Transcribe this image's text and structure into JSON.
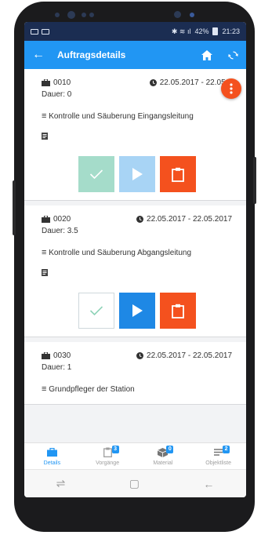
{
  "status_bar": {
    "battery": "42%",
    "time": "21:23"
  },
  "app_bar": {
    "title": "Auftragsdetails",
    "back_icon": "arrow-left-icon",
    "home_icon": "home-icon",
    "refresh_icon": "refresh-icon"
  },
  "orders": [
    {
      "id": "0010",
      "date": "22.05.2017 - 22.05.2",
      "duration": "Dauer: 0",
      "description": "Kontrolle und Säuberung Eingangsleitung"
    },
    {
      "id": "0020",
      "date": "22.05.2017 - 22.05.2017",
      "duration": "Dauer: 3.5",
      "description": "Kontrolle und Säuberung Abgangsleitung"
    },
    {
      "id": "0030",
      "date": "22.05.2017 - 22.05.2017",
      "duration": "Dauer: 1",
      "description": "Grundpfleger der Station"
    }
  ],
  "tabs": [
    {
      "label": "Details",
      "icon": "briefcase-icon",
      "badge": ""
    },
    {
      "label": "Vorgänge",
      "icon": "clipboard-icon",
      "badge": "3"
    },
    {
      "label": "Material",
      "icon": "box-icon",
      "badge": "0"
    },
    {
      "label": "Objektliste",
      "icon": "list-icon",
      "badge": "2"
    }
  ],
  "colors": {
    "primary": "#2196f3",
    "accent": "#f4511e",
    "success_light": "#a5dcca"
  }
}
